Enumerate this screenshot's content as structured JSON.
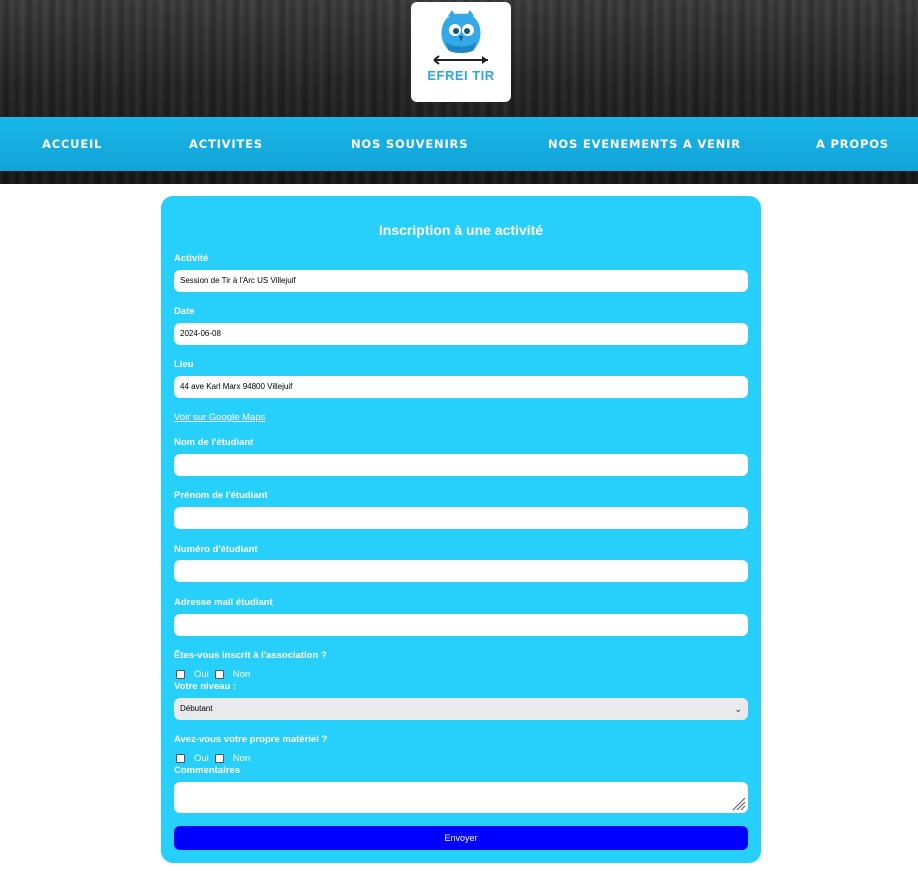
{
  "logo": {
    "text": "EFREI TIR",
    "icon": "owl-mascot-icon"
  },
  "nav": {
    "items": [
      {
        "label": "ACCUEIL"
      },
      {
        "label": "ACTIVITES"
      },
      {
        "label": "NOS SOUVENIRS"
      },
      {
        "label": "NOS EVENEMENTS A VENIR"
      },
      {
        "label": "A PROPOS"
      }
    ]
  },
  "form": {
    "title": "Inscription à une activité",
    "activity": {
      "label": "Activité",
      "value": "Session de Tir à l'Arc US Villejuif"
    },
    "date": {
      "label": "Date",
      "value": "2024-06-08"
    },
    "place": {
      "label": "Lieu",
      "value": "44 ave Karl Marx 94800 Villejuif"
    },
    "maps_link": "Voir sur Google Maps",
    "last_name": {
      "label": "Nom de l'étudiant",
      "value": ""
    },
    "first_name": {
      "label": "Prénom de l'étudiant",
      "value": ""
    },
    "student_number": {
      "label": "Numéro d'étudiant",
      "value": ""
    },
    "email": {
      "label": "Adresse mail étudiant",
      "value": ""
    },
    "member": {
      "label": "Êtes-vous inscrit à l'association ?",
      "yes": "Oui",
      "no": "Non"
    },
    "level": {
      "label": "Votre niveau :",
      "selected": "Débutant"
    },
    "equipment": {
      "label": "Avez-vous votre propre matériel ?",
      "yes": "Oui",
      "no": "Non"
    },
    "comments": {
      "label": "Commentaires",
      "value": ""
    },
    "submit_label": "Envoyer"
  },
  "colors": {
    "nav_bg": "#1ab6e8",
    "card_bg": "#27d0fb",
    "submit_bg": "#0000ff",
    "logo_blue": "#2aa7e6"
  }
}
